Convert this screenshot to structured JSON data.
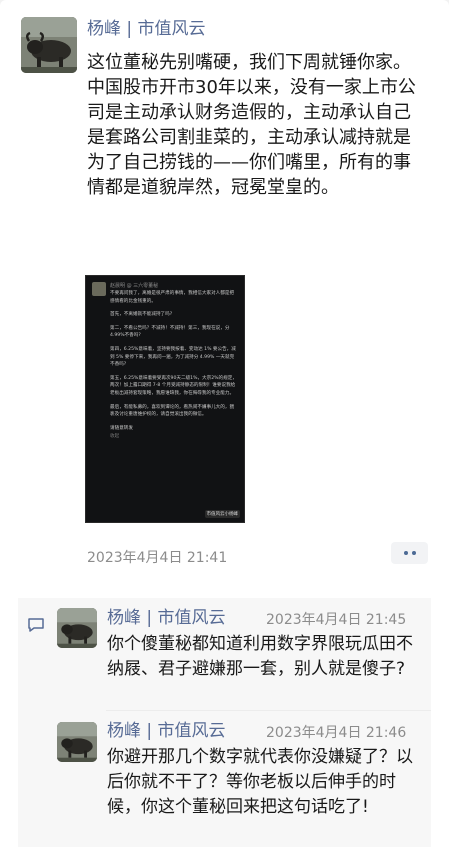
{
  "post": {
    "author": "杨峰 | 市值风云",
    "paragraphs": [
      "这位董秘先别嘴硬，我们下周就锤你家。",
      "中国股市开市30年以来，没有一家上市公司是主动承认财务造假的，主动承认自己是套路公司割韭菜的，主动承认减持就是为了自己捞钱的——你们嘴里，所有的事情都是道貌岸然，冠冕堂皇的。"
    ],
    "timestamp": "2023年4月4日 21:41",
    "image": {
      "author": "赵晨明 @ 三六零董秘",
      "tag": "市值风云小杨峰",
      "paragraphs": [
        "不要再问我了，离婚是很严肃的事情，我相信大家对人都是把感情看的比金钱重的。",
        "首先，不离婚就不能减持了吗?",
        "第二，不看公告吗？不减持！不减持！第三，我现在说，分4.99%不香吗?",
        "第四，6.25%意味着，坚持要我按着、变动达 1% 要公告，减到 5% 要停下来，我再问一遍，为了减持分 4.99% 一天就完不香吗?",
        "第五，6.25%意味着要受再次90天二级1%，大宗2%的规定，两次！加上露口期得 7-8 个月受减持静态的限制！谁要说我给老板出减持套现策略，我愿谁缺我，你在侮辱我的专业能力。",
        "最后，有能私募的，喜欢到谭论的，看热闹不嫌事儿大的，猥亵及讨论重唐维护权的，请自觉滚出我的微信。",
        "请随意转发",
        "收起"
      ]
    }
  },
  "comments": [
    {
      "author": "杨峰 | 市值风云",
      "time": "2023年4月4日 21:45",
      "text": "你个傻董秘都知道利用数字界限玩瓜田不纳屐、君子避嫌那一套，别人就是傻子?"
    },
    {
      "author": "杨峰 | 市值风云",
      "time": "2023年4月4日 21:46",
      "text": "你避开那几个数字就代表你没嫌疑了？以后你就不干了？等你老板以后伸手的时候，你这个董秘回来把这句话吃了!"
    }
  ],
  "colors": {
    "name_link": "#576b95",
    "text": "#191919",
    "meta": "#8c8c8c",
    "comment_bg": "#f7f7f7"
  },
  "icons": {
    "more": "more-dots-icon",
    "comment": "comment-icon"
  }
}
